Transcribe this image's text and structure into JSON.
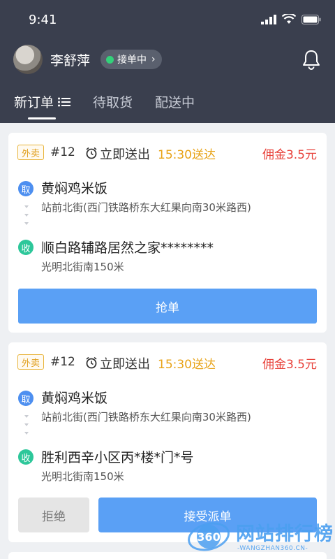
{
  "status_bar": {
    "time": "9:41"
  },
  "user": {
    "name": "李舒萍",
    "status_label": "接单中"
  },
  "tabs": [
    {
      "label": "新订单",
      "active": true
    },
    {
      "label": "待取货",
      "active": false
    },
    {
      "label": "配送中",
      "active": false
    }
  ],
  "orders": [
    {
      "tag": "外卖",
      "order_no": "#12",
      "send_type": "立即送出",
      "deadline": "15:30送达",
      "commission": "佣金3.5元",
      "pickup_badge": "取",
      "pickup_name": "黄焖鸡米饭",
      "pickup_address": "站前北街(西门铁路桥东大红果向南30米路西)",
      "dropoff_badge": "收",
      "dropoff_name": "顺白路辅路居然之家********",
      "dropoff_address": "光明北街南150米",
      "action_label": "抢单"
    },
    {
      "tag": "外卖",
      "order_no": "#12",
      "send_type": "立即送出",
      "deadline": "15:30送达",
      "commission": "佣金3.5元",
      "pickup_badge": "取",
      "pickup_name": "黄焖鸡米饭",
      "pickup_address": "站前北街(西门铁路桥东大红果向南30米路西)",
      "dropoff_badge": "收",
      "dropoff_name": "胜利西辛小区丙*楼*门*号",
      "dropoff_address": "光明北街南150米",
      "reject_label": "拒绝",
      "accept_label": "接受派单"
    }
  ],
  "watermark": {
    "logo_text": "360",
    "title": "网站排行榜",
    "subtitle": "-WANGZHAN360.CN-"
  },
  "colors": {
    "header_bg": "#3a3f4e",
    "accent_blue": "#5aa0f5",
    "online_green": "#33d17a",
    "deadline_orange": "#e8a317",
    "commission_red": "#e8413a",
    "pickup_badge": "#4d8ff0",
    "dropoff_badge": "#2dc79a"
  }
}
